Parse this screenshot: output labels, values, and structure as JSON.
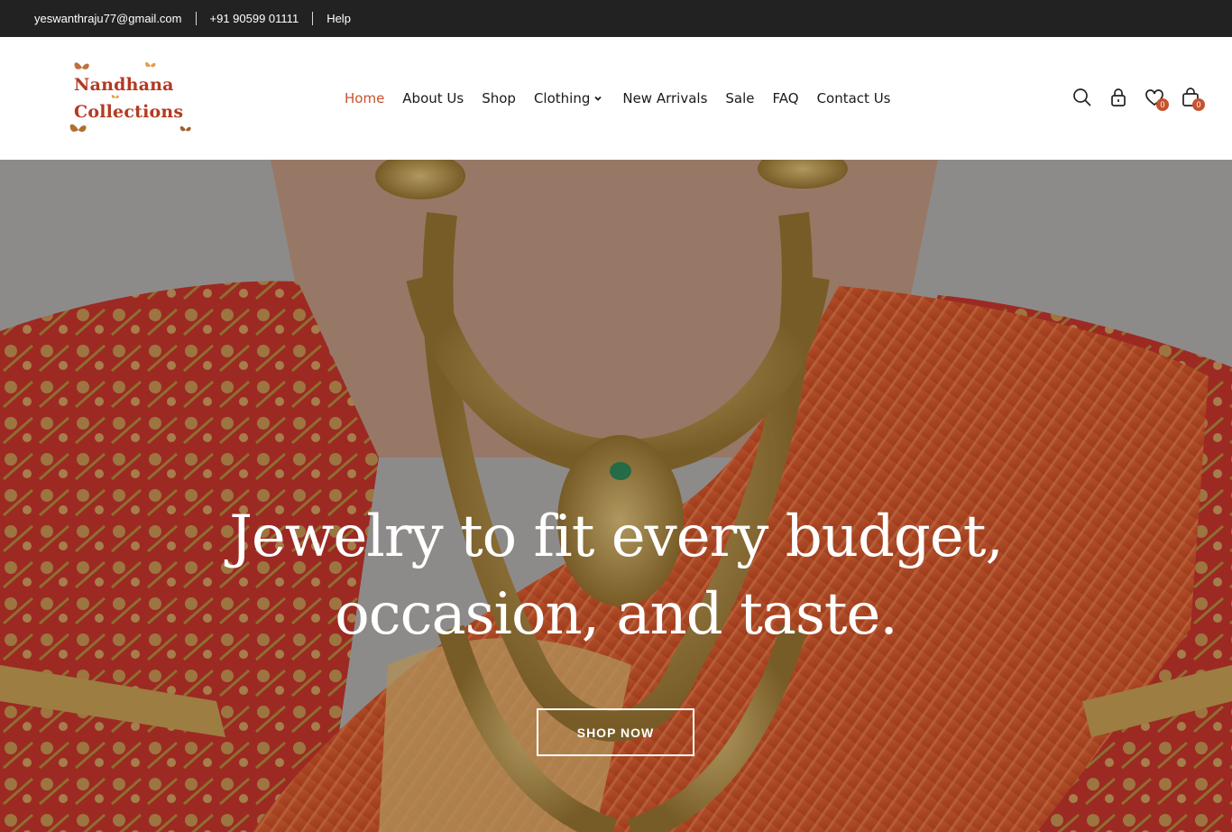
{
  "topbar": {
    "email": "yeswanthraju77@gmail.com",
    "phone": "+91 90599 01111",
    "help": "Help"
  },
  "brand": {
    "line1": "Nandhana",
    "line2": "Collections",
    "color": "#b33a22"
  },
  "nav": {
    "items": [
      {
        "label": "Home",
        "active": true
      },
      {
        "label": "About Us"
      },
      {
        "label": "Shop"
      },
      {
        "label": "Clothing",
        "dropdown": true
      },
      {
        "label": "New Arrivals"
      },
      {
        "label": "Sale"
      },
      {
        "label": "FAQ"
      },
      {
        "label": "Contact Us"
      }
    ],
    "accent": "#c4532f"
  },
  "header_icons": {
    "search": "search-icon",
    "account": "lock-icon",
    "wishlist": {
      "icon": "heart-icon",
      "count": "0"
    },
    "cart": {
      "icon": "bag-icon",
      "count": "0"
    }
  },
  "hero": {
    "title_line1": "Jewelry to fit every budget,",
    "title_line2": "occasion, and taste.",
    "cta": "SHOP NOW"
  }
}
